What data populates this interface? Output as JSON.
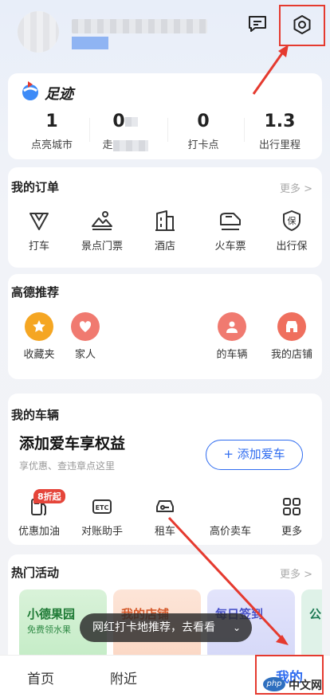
{
  "header": {
    "message_icon": "message-icon",
    "settings_icon": "settings-hex-icon"
  },
  "footprint": {
    "title": "足迹",
    "stats": [
      {
        "value": "1",
        "label": "点亮城市"
      },
      {
        "value": "0",
        "label": "走"
      },
      {
        "value": "0",
        "label": "打卡点"
      },
      {
        "value": "1.3",
        "label": "出行里程"
      }
    ]
  },
  "orders": {
    "title": "我的订单",
    "more": "更多 >",
    "items": [
      {
        "label": "打车",
        "icon": "taxi-icon"
      },
      {
        "label": "景点门票",
        "icon": "scenic-ticket-icon"
      },
      {
        "label": "酒店",
        "icon": "hotel-icon"
      },
      {
        "label": "火车票",
        "icon": "train-icon"
      },
      {
        "label": "出行保",
        "icon": "insurance-icon"
      }
    ]
  },
  "recommend": {
    "title": "高德推荐",
    "items": [
      {
        "label": "收藏夹",
        "icon": "favorites-icon"
      },
      {
        "label": "家人",
        "icon": "family-icon"
      },
      {
        "label": "的车辆",
        "icon": "vehicle-icon"
      },
      {
        "label": "我的店铺",
        "icon": "shop-icon"
      }
    ]
  },
  "vehicle": {
    "title": "我的车辆",
    "headline": "添加爱车享权益",
    "subtitle": "享优惠、查违章点这里",
    "add_button": "+ 添加爱车",
    "badge": "8折起",
    "items": [
      {
        "label": "优惠加油",
        "icon": "fuel-icon"
      },
      {
        "label": "对账助手",
        "icon": "etc-icon"
      },
      {
        "label": "租车",
        "icon": "car-rental-icon"
      },
      {
        "label": "高价卖车",
        "icon": "sell-car-icon"
      },
      {
        "label": "更多",
        "icon": "grid-more-icon"
      }
    ]
  },
  "activities": {
    "title": "热门活动",
    "more": "更多 >",
    "cards": [
      {
        "title": "小德果园",
        "subtitle": "免费领水果"
      },
      {
        "title": "我的店铺",
        "subtitle": ""
      },
      {
        "title": "每日签到",
        "subtitle": ""
      },
      {
        "title": "公",
        "subtitle": ""
      }
    ]
  },
  "toast": {
    "text": "网红打卡地推荐，去看看"
  },
  "tabbar": {
    "home": "首页",
    "nearby": "附近",
    "mine": "我的"
  },
  "watermark": "中文网",
  "colors": {
    "accent": "#2f6cf0",
    "annotation_red": "#e53a2f",
    "orange": "#f5a623"
  }
}
